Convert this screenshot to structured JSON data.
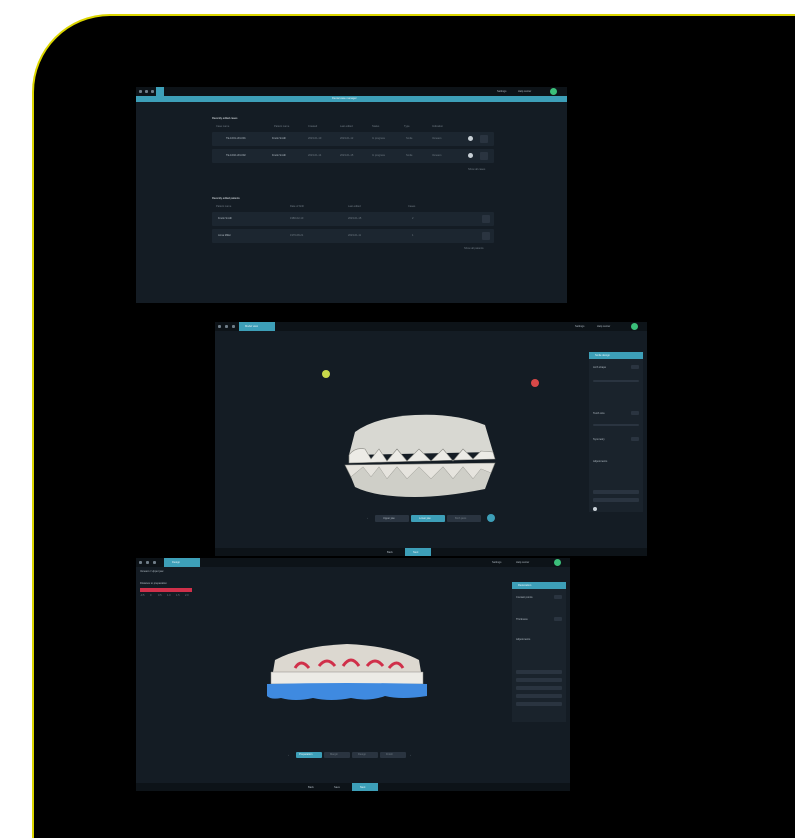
{
  "screen1": {
    "title": "Dental case manager",
    "section1_title": "Recently edited cases",
    "section2_title": "Recently edited patients",
    "columns1": [
      "Case name",
      "Patient name",
      "Created",
      "Last edited",
      "Status",
      "Type",
      "Indication"
    ],
    "rows1": [
      {
        "name": "TE-1001-UN-001",
        "patient": "Frank Smith",
        "created": "2023-01-10",
        "edited": "2023-01-12",
        "status": "In progress",
        "type": "Smile",
        "indication": "Veneers"
      },
      {
        "name": "TE-1002-UN-002",
        "patient": "Frank Smith",
        "created": "2023-01-14",
        "edited": "2023-01-15",
        "status": "In progress",
        "type": "Smile",
        "indication": "Veneers"
      }
    ],
    "columns2": [
      "Patient name",
      "Date of birth",
      "Last edited",
      "Cases"
    ],
    "rows2": [
      {
        "patient": "Frank Smith",
        "dob": "1980-02-10",
        "edited": "2023-01-15",
        "cases": "2"
      },
      {
        "patient": "Anna Miller",
        "dob": "1976-08-21",
        "edited": "2023-01-11",
        "cases": "1"
      }
    ],
    "show_all_1": "Show all cases",
    "show_all_2": "Show all patients",
    "header_right": [
      "Settings",
      "Help center"
    ]
  },
  "screen2": {
    "tab": "Model view",
    "header_right": [
      "Settings",
      "Help center"
    ],
    "panel_title": "Smile design",
    "panel_labels": [
      "Arch shape",
      "Tooth size",
      "Symmetry",
      "Adjustments"
    ],
    "bottom_tabs": [
      "Upper jaw",
      "Lower jaw",
      "Both jaws"
    ],
    "footer_buttons": [
      "Back",
      "Next"
    ]
  },
  "screen3": {
    "tab": "Design",
    "subtitle": "Veneers / Upper jaw",
    "header_right": [
      "Settings",
      "Help center"
    ],
    "legend_title": "Distance to preparation",
    "legend_ticks": [
      "-0.5",
      "0",
      "0.5",
      "1.0",
      "1.5",
      "2.0"
    ],
    "panel_title": "Restoration",
    "panel_labels": [
      "Contact points",
      "Thickness",
      "Adjustments"
    ],
    "bottom_tabs": [
      "Preparation",
      "Margin",
      "Design",
      "Finish"
    ],
    "footer_buttons": [
      "Back",
      "Save",
      "Next"
    ]
  },
  "colors": {
    "accent": "#3d9fb8",
    "frame_border": "#dcd600",
    "tooth_highlight_red": "#d0304a",
    "tooth_base_blue": "#3f8ae0"
  }
}
